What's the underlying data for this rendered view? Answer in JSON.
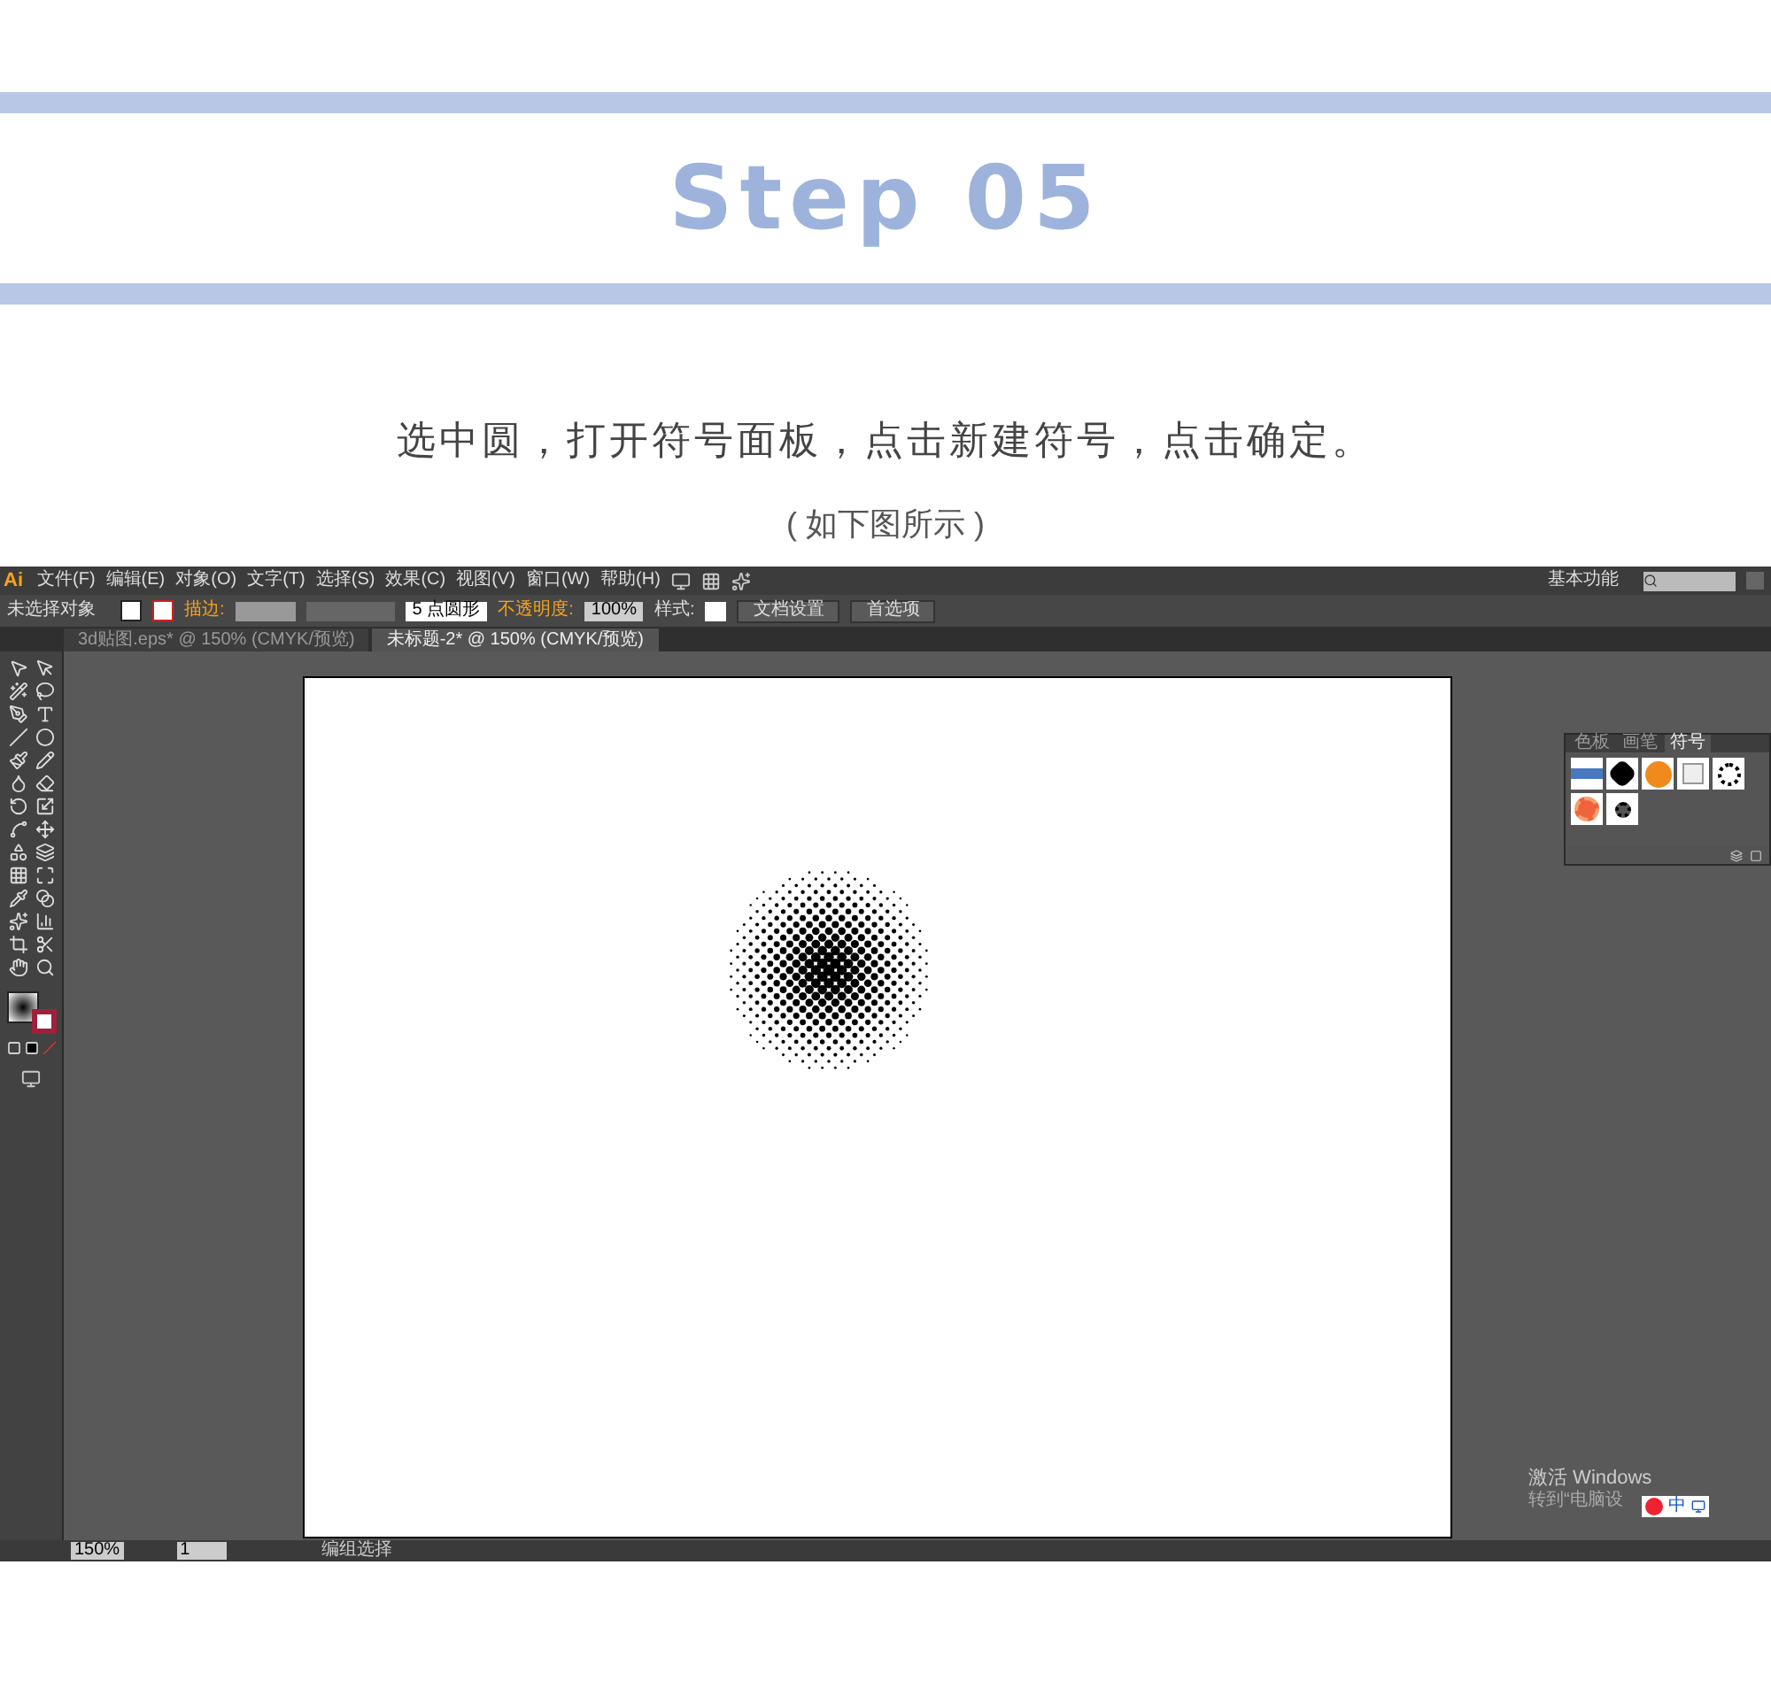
{
  "heading": {
    "title": "Step 05"
  },
  "instruction": {
    "text": "选中圆，打开符号面板，点击新建符号，点击确定。",
    "note": "( 如下图所示 )"
  },
  "app": {
    "logo": "Ai",
    "menu": [
      "文件(F)",
      "编辑(E)",
      "对象(O)",
      "文字(T)",
      "选择(S)",
      "效果(C)",
      "视图(V)",
      "窗口(W)",
      "帮助(H)"
    ],
    "workspace": "基本功能",
    "control_bar": {
      "selection": "未选择对象",
      "stroke_label": "描边:",
      "brush": "5 点圆形",
      "opacity_label": "不透明度:",
      "opacity": "100%",
      "style_label": "样式:",
      "buttons": [
        "文档设置",
        "首选项"
      ]
    },
    "tabs": [
      {
        "label": "3d贴图.eps* @ 150% (CMYK/预览)",
        "selected": false
      },
      {
        "label": "未标题-2* @ 150% (CMYK/预览)",
        "selected": true
      }
    ],
    "panel": {
      "tabs": [
        {
          "label": "色板",
          "selected": false
        },
        {
          "label": "画笔",
          "selected": false
        },
        {
          "label": "符号",
          "selected": true
        }
      ]
    },
    "status_bar": {
      "zoom": "150%",
      "artboard": "1",
      "tool": "编组选择"
    },
    "activation": {
      "title": "激活 Windows",
      "hint": "转到“电脑设"
    },
    "ime": "中"
  }
}
